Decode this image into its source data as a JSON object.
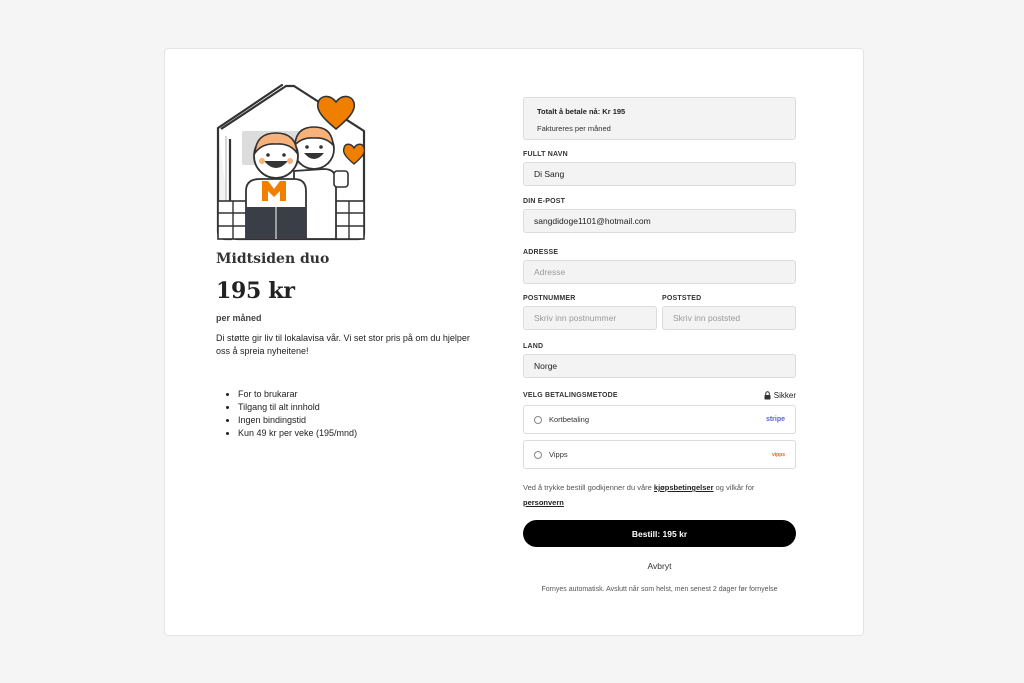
{
  "product": {
    "name": "Midtsiden duo",
    "price": "195 kr",
    "period": "per måned",
    "description": "Di støtte gir liv til lokalavisa vår. Vi set stor pris på om du hjelper oss å spreia nyheitene!",
    "features": [
      "For to brukarar",
      "Tilgang til alt innhold",
      "Ingen bindingstid",
      "Kun 49 kr per veke (195/mnd)"
    ]
  },
  "summary": {
    "total": "Totalt å betale nå: Kr 195",
    "billing": "Faktureres per måned"
  },
  "form": {
    "full_name": {
      "label": "FULLT NAVN",
      "value": "Di Sang"
    },
    "email": {
      "label": "DIN E-POST",
      "value": "sangdidoge1101@hotmail.com"
    },
    "address": {
      "label": "ADRESSE",
      "placeholder": "Adresse"
    },
    "postal_code": {
      "label": "POSTNUMMER",
      "placeholder": "Skriv inn postnummer"
    },
    "city": {
      "label": "POSTSTED",
      "placeholder": "Skriv inn poststed"
    },
    "country": {
      "label": "LAND",
      "value": "Norge"
    }
  },
  "payment": {
    "label": "VELG BETALINGSMETODE",
    "secure": "Sikker",
    "options": [
      {
        "label": "Kortbetaling",
        "logo": "stripe"
      },
      {
        "label": "Vipps",
        "logo": "vipps"
      }
    ]
  },
  "terms": {
    "prefix": "Ved å trykke bestill godkjenner du våre",
    "link1": "kjøpsbetingelser",
    "middle": "og vilkår for",
    "link2": "personvern"
  },
  "actions": {
    "order": "Bestill: 195 kr",
    "cancel": "Avbryt"
  },
  "footer": "Fornyes automatisk. Avslutt når som helst, men senest 2 dager før fornyelse",
  "colors": {
    "accent": "#f07f00",
    "button": "#000000",
    "field_bg": "#f3f3f3"
  }
}
